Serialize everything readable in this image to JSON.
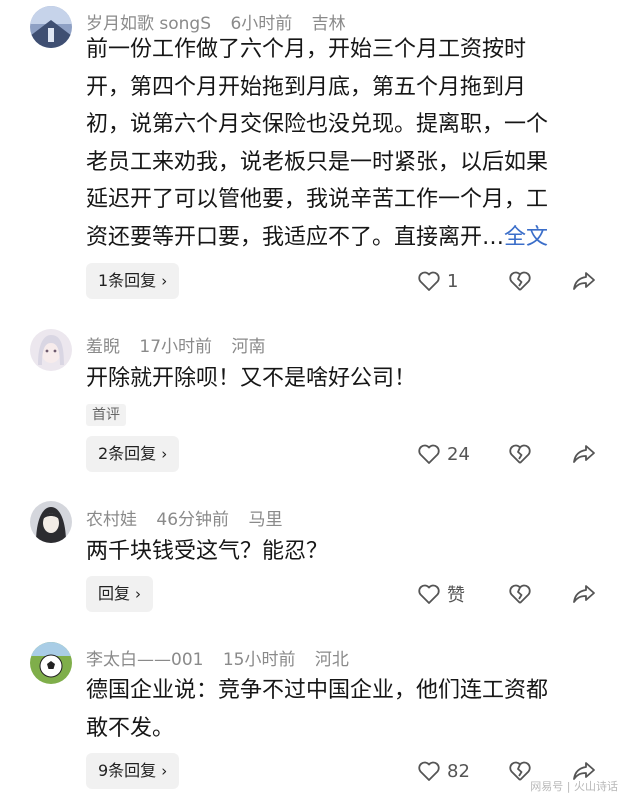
{
  "comments": [
    {
      "user": "岁月如歌 songS",
      "time": "6小时前",
      "location": "吉林",
      "lines": [
        "前一份工作做了六个月，开始三个月工资按时",
        "开，第四个月开始拖到月底，第五个月拖到月",
        "初，说第六个月交保险也没兑现。提离职，一个",
        "老员工来劝我，说老板只是一时紧张，以后如果",
        "延迟开了可以管他要，我说辛苦工作一个月，工",
        "资还要等开口要，我适应不了。直接离开…"
      ],
      "more": "全文",
      "reply_label": "1条回复",
      "likes": "1"
    },
    {
      "user": "羞睨",
      "time": "17小时前",
      "location": "河南",
      "lines": [
        "开除就开除呗！又不是啥好公司！"
      ],
      "tag": "首评",
      "reply_label": "2条回复",
      "likes": "24"
    },
    {
      "user": "农村娃",
      "time": "46分钟前",
      "location": "马里",
      "lines": [
        "两千块钱受这气？能忍？"
      ],
      "reply_label": "回复",
      "likes": "赞"
    },
    {
      "user": "李太白——001",
      "time": "15小时前",
      "location": "河北",
      "lines": [
        "德国企业说：竞争不过中国企业，他们连工资都",
        "敢不发。"
      ],
      "reply_label": "9条回复",
      "likes": "82"
    }
  ],
  "icons": {
    "like": "heart-outline-icon",
    "dislike": "broken-heart-icon",
    "share": "share-arrow-icon",
    "reply_chevron": "chevron-right-icon"
  },
  "watermark": "网易号 | 火山诗话"
}
